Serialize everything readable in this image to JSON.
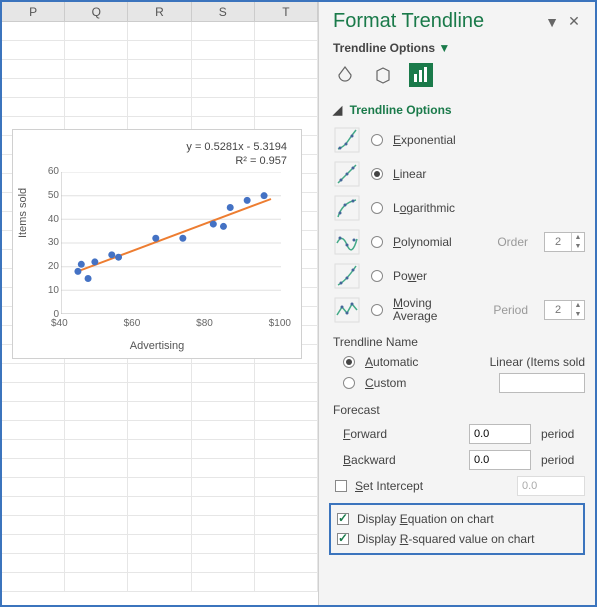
{
  "columns": [
    "P",
    "Q",
    "R",
    "S",
    "T"
  ],
  "chart": {
    "equation": "y = 0.5281x - 5.3194",
    "r2": "R² = 0.957",
    "ylabel": "Items sold",
    "xlabel": "Advertising",
    "yticks": [
      "0",
      "10",
      "20",
      "30",
      "40",
      "50",
      "60"
    ],
    "xticks": [
      "$40",
      "$60",
      "$80",
      "$100"
    ]
  },
  "chart_data": {
    "type": "scatter",
    "title": "",
    "xlabel": "Advertising",
    "ylabel": "Items sold",
    "xlim": [
      40,
      105
    ],
    "ylim": [
      0,
      60
    ],
    "series": [
      {
        "name": "Items sold",
        "points": [
          {
            "x": 45,
            "y": 18
          },
          {
            "x": 46,
            "y": 21
          },
          {
            "x": 48,
            "y": 15
          },
          {
            "x": 50,
            "y": 22
          },
          {
            "x": 55,
            "y": 25
          },
          {
            "x": 57,
            "y": 24
          },
          {
            "x": 68,
            "y": 32
          },
          {
            "x": 76,
            "y": 32
          },
          {
            "x": 85,
            "y": 38
          },
          {
            "x": 88,
            "y": 37
          },
          {
            "x": 90,
            "y": 45
          },
          {
            "x": 95,
            "y": 48
          },
          {
            "x": 100,
            "y": 50
          }
        ]
      }
    ],
    "trendline": {
      "type": "linear",
      "slope": 0.5281,
      "intercept": -5.3194,
      "r2": 0.957
    }
  },
  "pane": {
    "title": "Format Trendline",
    "options_label": "Trendline Options",
    "section": "Trendline Options",
    "types": {
      "exponential": "Exponential",
      "linear": "Linear",
      "logarithmic": "Logarithmic",
      "polynomial": "Polynomial",
      "power": "Power",
      "moving_average_1": "Moving",
      "moving_average_2": "Average",
      "order_label": "Order",
      "order_value": "2",
      "period_label": "Period",
      "period_value": "2"
    },
    "name": {
      "heading": "Trendline Name",
      "automatic": "Automatic",
      "auto_value": "Linear (Items sold",
      "custom": "Custom"
    },
    "forecast": {
      "heading": "Forecast",
      "forward": "Forward",
      "backward": "Backward",
      "forward_value": "0.0",
      "backward_value": "0.0",
      "unit": "period",
      "set_intercept": "Set Intercept",
      "set_intercept_value": "0.0"
    },
    "display": {
      "equation": "Display Equation on chart",
      "r2": "Display R-squared value on chart"
    }
  }
}
